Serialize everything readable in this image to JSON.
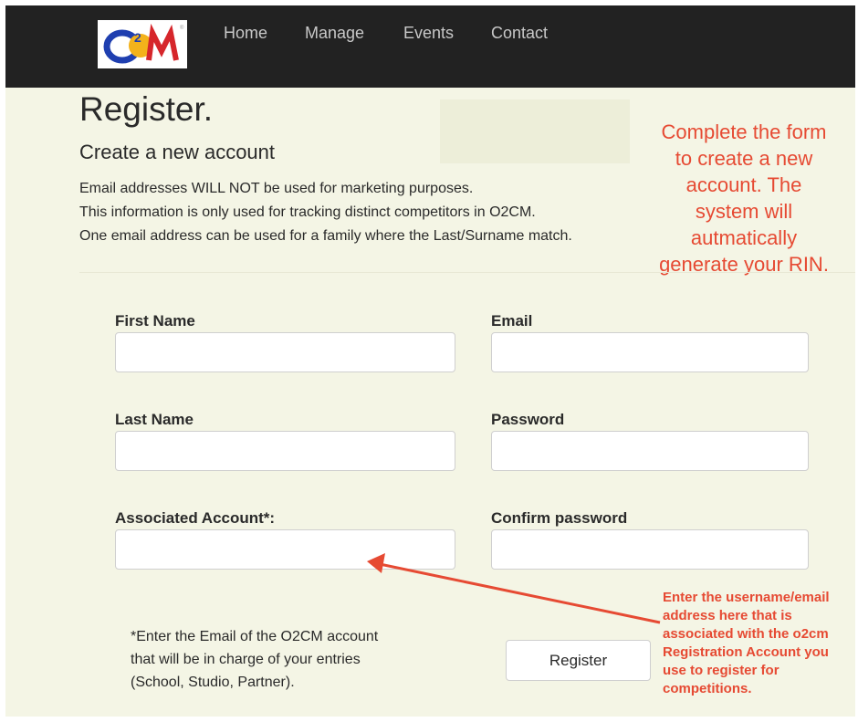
{
  "nav": {
    "logo_text": "O2CM",
    "links": [
      "Home",
      "Manage",
      "Events",
      "Contact"
    ]
  },
  "header": {
    "title": "Register.",
    "subtitle": "Create a new account",
    "info_lines": [
      "Email addresses WILL NOT be used for marketing purposes.",
      "This information is only used for tracking distinct competitors in O2CM.",
      "One email address can be used for a family where the Last/Surname match."
    ]
  },
  "annotation_top": {
    "lines": [
      "Complete the form",
      "to create a new",
      "account. The",
      "system will",
      "autmatically",
      "generate your RIN."
    ]
  },
  "form": {
    "first_name_label": "First Name",
    "email_label": "Email",
    "last_name_label": "Last Name",
    "password_label": "Password",
    "associated_label": "Associated Account*:",
    "confirm_label": "Confirm password",
    "first_name_value": "",
    "email_value": "",
    "last_name_value": "",
    "password_value": "",
    "associated_value": "",
    "confirm_value": ""
  },
  "note": {
    "lines": [
      "*Enter the Email of the O2CM account",
      "that will be in charge of your entries",
      "(School, Studio, Partner)."
    ]
  },
  "register_label": "Register",
  "annotation_bottom": {
    "lines": [
      "Enter the username/email",
      "address here that is",
      "associated with the o2cm",
      "Registration Account you",
      "use to register for",
      "competitions."
    ]
  },
  "colors": {
    "background": "#f4f5e5",
    "navbar": "#222222",
    "annotation": "#e64a33"
  }
}
